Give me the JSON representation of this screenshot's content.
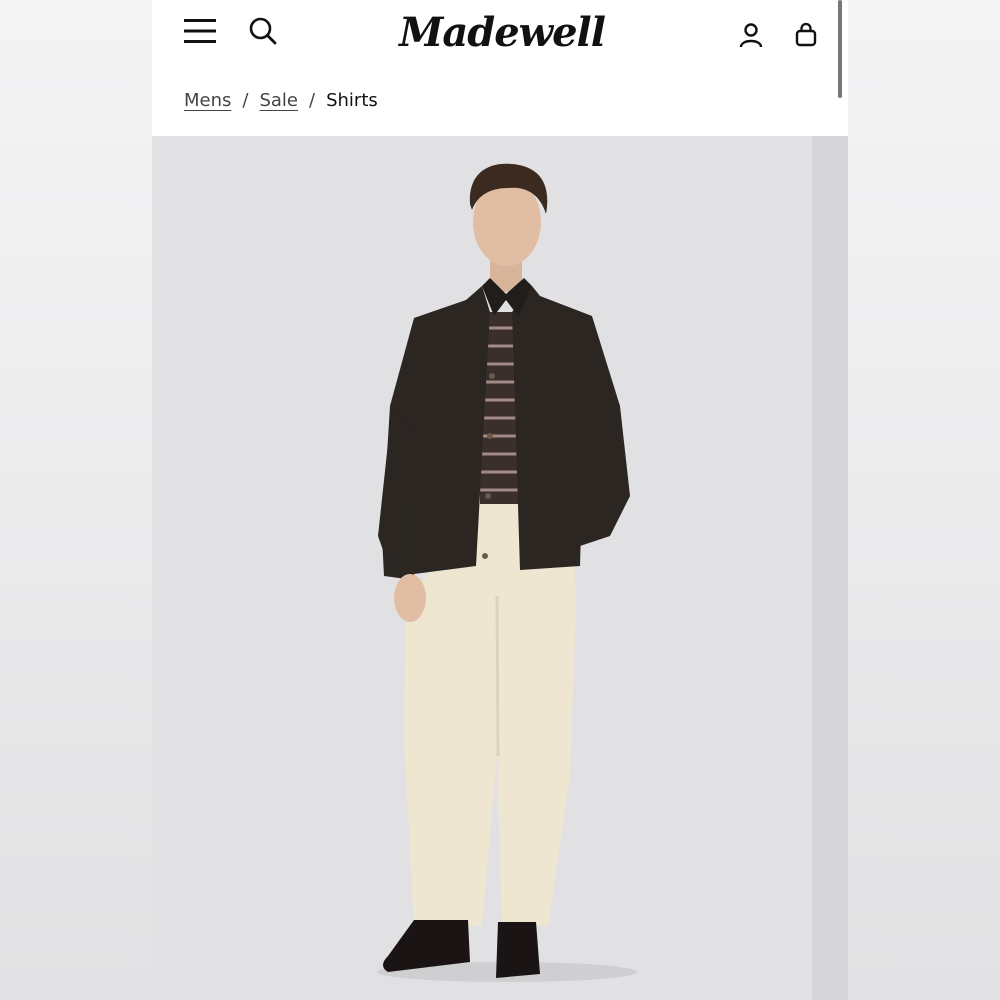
{
  "header": {
    "brand": "Madewell",
    "icons": {
      "menu": "hamburger-menu-icon",
      "search": "search-icon",
      "account": "user-icon",
      "bag": "shopping-bag-icon"
    }
  },
  "breadcrumb": {
    "items": [
      {
        "label": "Mens"
      },
      {
        "label": "Sale"
      },
      {
        "label": "Shirts"
      }
    ],
    "separator": "/"
  },
  "product_image": {
    "description_colors": {
      "background": "#e1e1e3",
      "jacket": "#2b2622",
      "pants": "#efe6d2",
      "shoes": "#1a1414"
    }
  }
}
